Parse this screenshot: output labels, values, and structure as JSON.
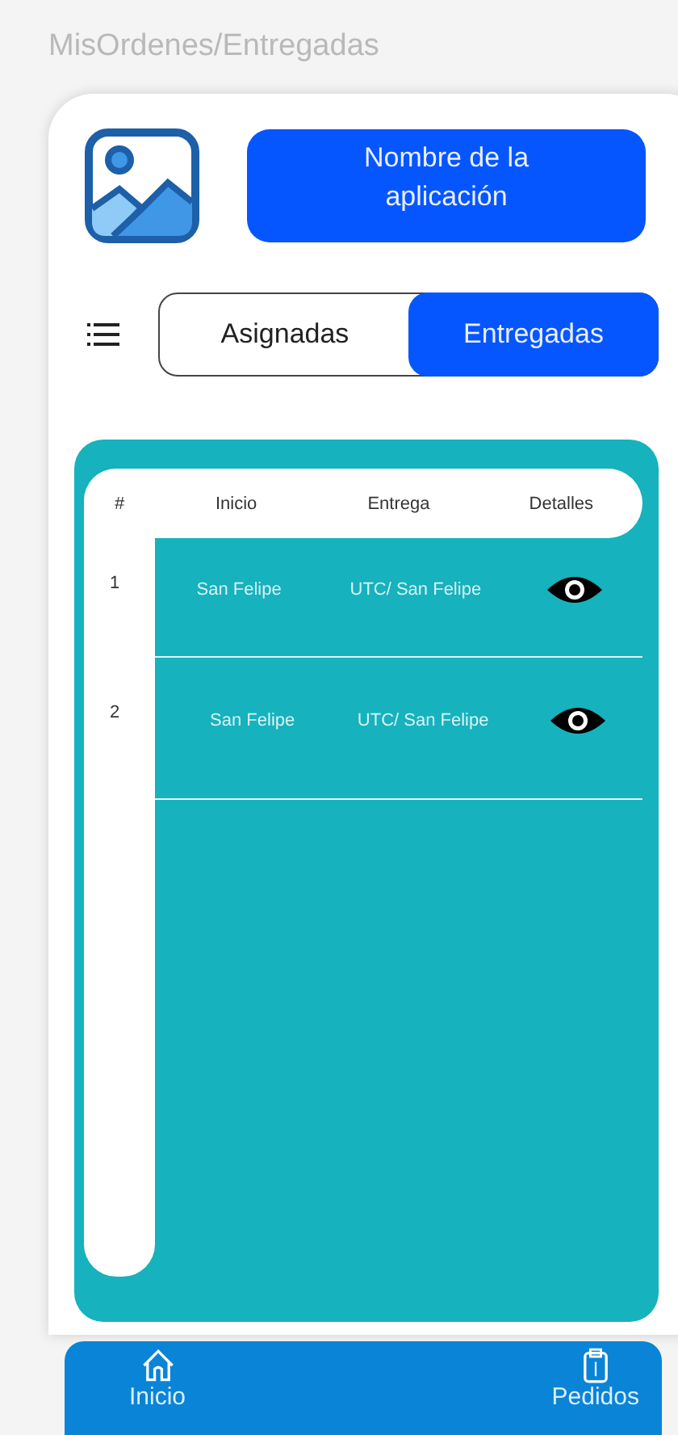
{
  "window": {
    "title": "MisOrdenes/Entregadas"
  },
  "header": {
    "app_name": "Nombre de la aplicación"
  },
  "tabs": [
    {
      "label": "Asignadas",
      "selected": false
    },
    {
      "label": "Entregadas",
      "selected": true
    }
  ],
  "table": {
    "columns": [
      "#",
      "Inicio",
      "Entrega",
      "Detalles"
    ],
    "rows": [
      {
        "index": "1",
        "inicio": "San Felipe",
        "entrega": "UTC/ San Felipe"
      },
      {
        "index": "2",
        "inicio": "San Felipe",
        "entrega": "UTC/ San Felipe"
      }
    ]
  },
  "bottom_nav": [
    {
      "label": "Inicio",
      "kind": "home"
    },
    {
      "label": "Pedidos",
      "kind": "orders"
    }
  ]
}
